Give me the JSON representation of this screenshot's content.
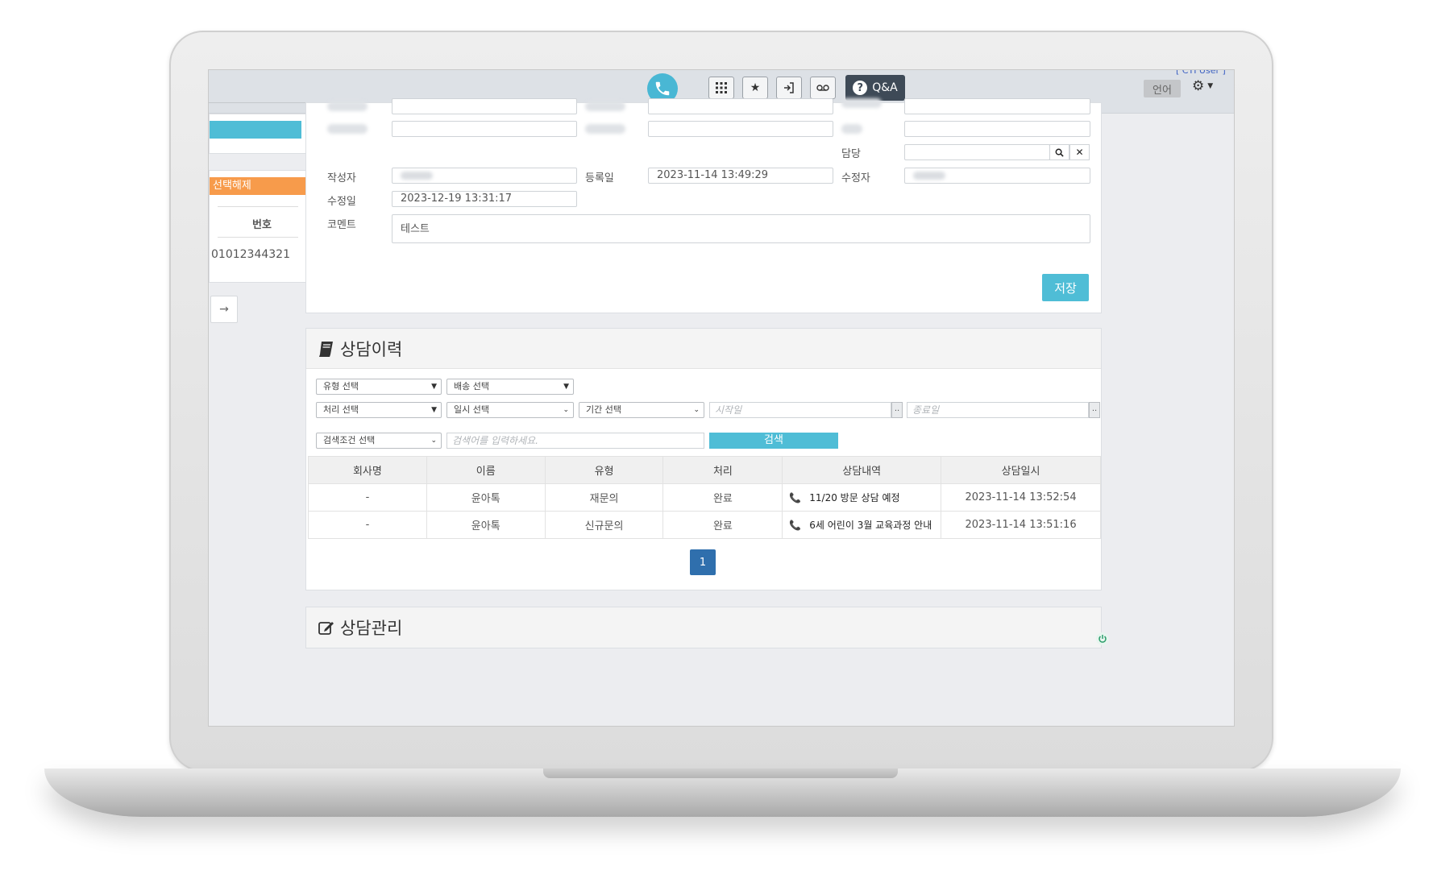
{
  "topbar": {
    "qa_label": "Q&A",
    "user_label": "[ CTI User ]",
    "lang_label": "언어"
  },
  "left_panel": {
    "deselect_label": "선택해제",
    "column_header": "번호",
    "phone_number": "01012344321",
    "arrow_label": "→"
  },
  "form": {
    "manager_label": "담당",
    "writer_label": "작성자",
    "registered_label": "등록일",
    "registered_value": "2023-11-14 13:49:29",
    "modifier_label": "수정자",
    "modified_label": "수정일",
    "modified_value": "2023-12-19 13:31:17",
    "comment_label": "코멘트",
    "comment_value": "테스트",
    "save_label": "저장"
  },
  "history": {
    "title": "상담이력",
    "filters": {
      "type_select": "유형 선택",
      "delivery_select": "배송 선택",
      "process_select": "처리 선택",
      "datetime_select": "일시 선택",
      "period_select": "기간 선택",
      "start_placeholder": "시작일",
      "end_placeholder": "종료일",
      "date_btn": "..",
      "condition_select": "검색조건 선택",
      "search_placeholder": "검색어를 입력하세요.",
      "search_label": "검색"
    },
    "table": {
      "headers": [
        "회사명",
        "이름",
        "유형",
        "처리",
        "상담내역",
        "상담일시"
      ],
      "rows": [
        {
          "company": "-",
          "name": "윤아톡",
          "type": "재문의",
          "status": "완료",
          "content": "11/20 방문 상담 예정",
          "datetime": "2023-11-14 13:52:54"
        },
        {
          "company": "-",
          "name": "윤아톡",
          "type": "신규문의",
          "status": "완료",
          "content": "6세 어린이 3월 교육과정 안내",
          "datetime": "2023-11-14 13:51:16"
        }
      ]
    },
    "page": "1"
  },
  "manage": {
    "title": "상담관리"
  },
  "colors": {
    "accent": "#4fbdd6",
    "deselect": "#f79b4b",
    "pagination": "#2f6fad",
    "qa_button": "#3e4a57"
  }
}
